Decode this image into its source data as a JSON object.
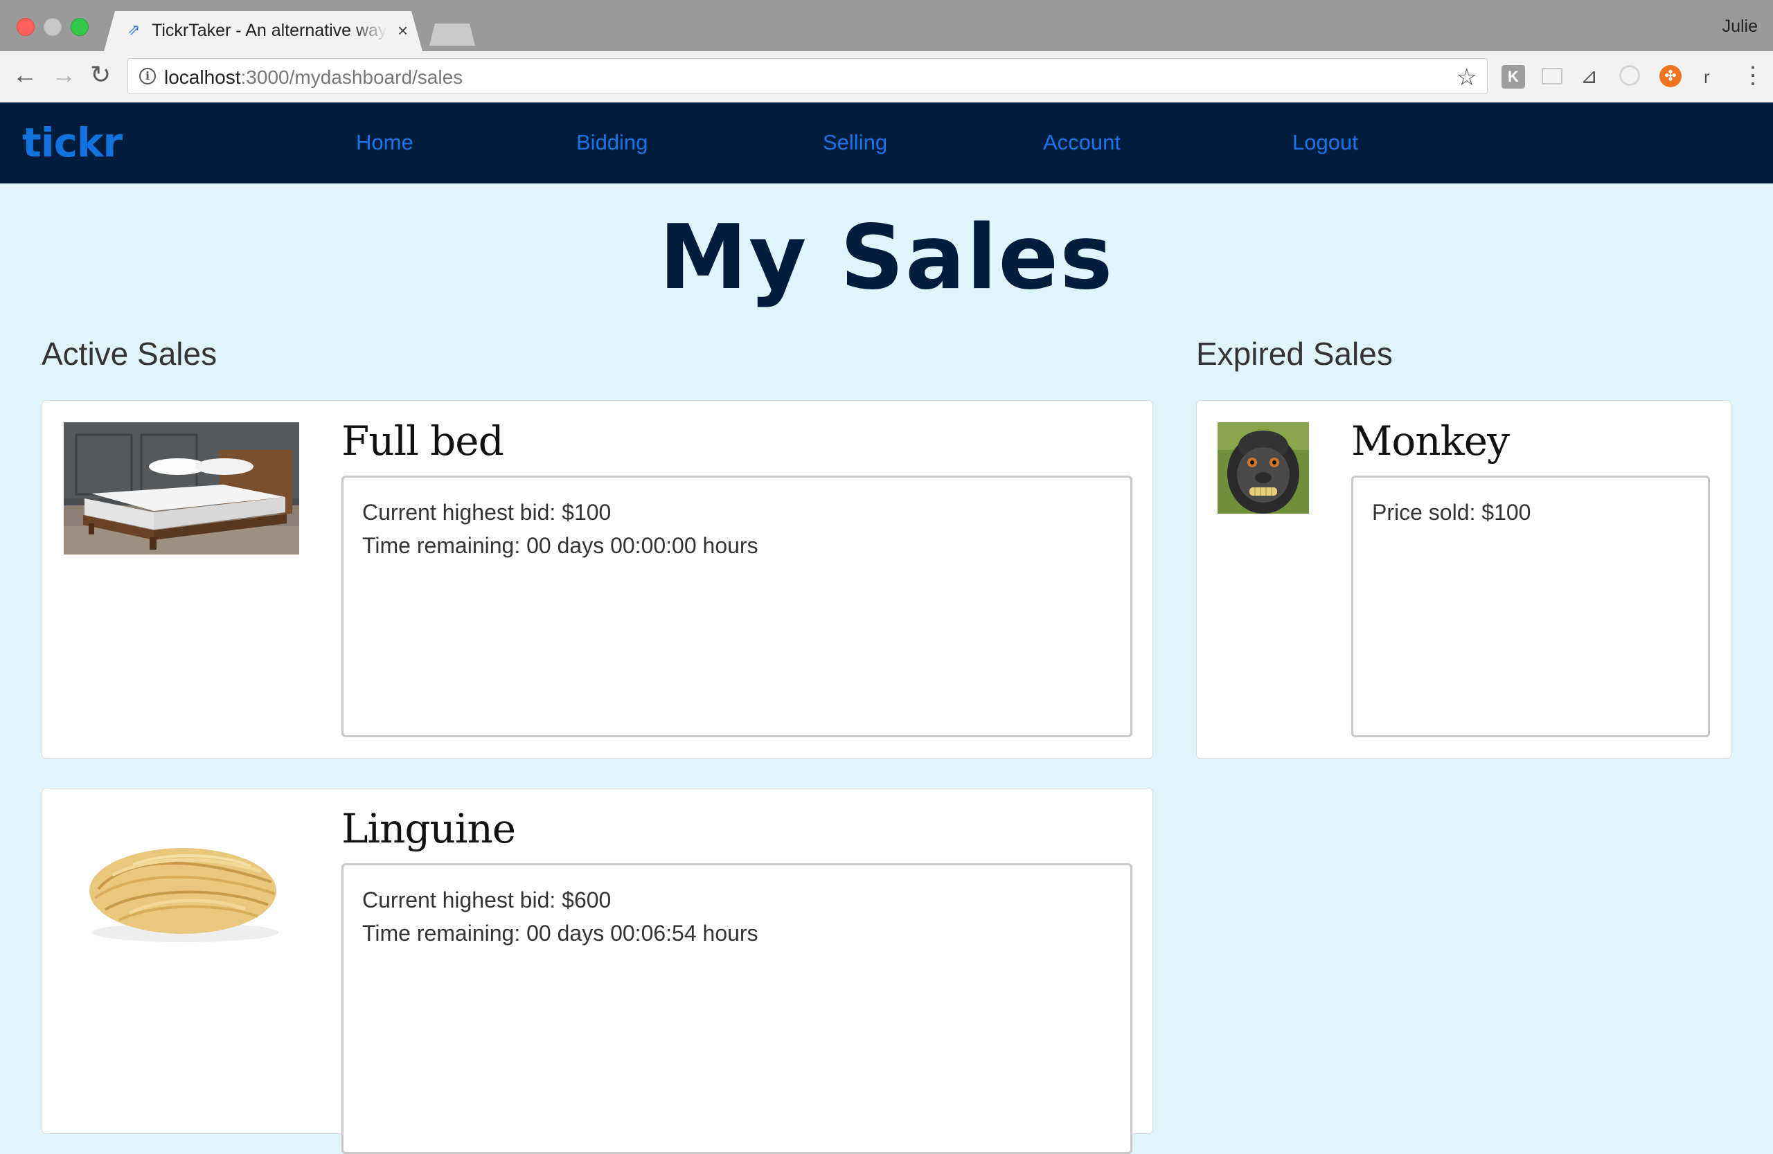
{
  "browser": {
    "tab_title": "TickrTaker - An alternative way to buy and sell",
    "tab_close": "×",
    "profile_name": "Julie",
    "url_host": "localhost",
    "url_path": ":3000/mydashboard/sales"
  },
  "navbar": {
    "brand": "tickr",
    "links": [
      "Home",
      "Bidding",
      "Selling",
      "Account",
      "Logout"
    ]
  },
  "page": {
    "title": "My Sales",
    "active_heading": "Active Sales",
    "expired_heading": "Expired Sales"
  },
  "active_sales": [
    {
      "title": "Full bed",
      "line1": "Current highest bid: $100",
      "line2": "Time remaining: 00 days 00:00:00 hours"
    },
    {
      "title": "Linguine",
      "line1": "Current highest bid: $600",
      "line2": "Time remaining: 00 days 00:06:54 hours"
    }
  ],
  "expired_sales": [
    {
      "title": "Monkey",
      "line1": "Price sold: $100"
    }
  ],
  "colors": {
    "navbar_bg": "#001d3d",
    "link": "#1a73e8",
    "page_bg": "#e0f4fb"
  }
}
